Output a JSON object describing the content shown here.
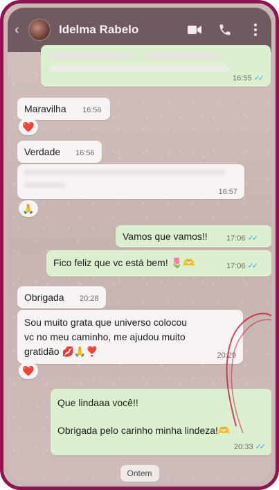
{
  "header": {
    "back_icon": "arrow-left-icon",
    "contact_name": "Idelma Rabelo",
    "actions": [
      "video-call-icon",
      "phone-icon",
      "more-vert-icon"
    ]
  },
  "messages": [
    {
      "id": "m0",
      "direction": "out",
      "text": "",
      "time": "16:55",
      "ticks": "✓✓"
    },
    {
      "id": "m1",
      "direction": "in",
      "text": "Maravilha",
      "time": "16:56",
      "reaction": "❤️"
    },
    {
      "id": "m2",
      "direction": "in",
      "text": "Verdade",
      "time": "16:56"
    },
    {
      "id": "m3",
      "direction": "in",
      "text": "",
      "time": "16:57",
      "reaction": "🙏"
    },
    {
      "id": "m4",
      "direction": "out",
      "text": "Vamos que vamos!!",
      "time": "17:06",
      "ticks": "✓✓"
    },
    {
      "id": "m5",
      "direction": "out",
      "text": "Fico feliz que vc está bem! 🌷🫶",
      "time": "17:06",
      "ticks": "✓✓"
    },
    {
      "id": "m6",
      "direction": "in",
      "text": "Obrigada",
      "time": "20:28"
    },
    {
      "id": "m7",
      "direction": "in",
      "lines": [
        "Sou muito grata que universo colocou",
        "vc no meu caminho, me ajudou muito",
        "gratidão 💋🙏❣️"
      ],
      "time": "20:29",
      "reaction": "❤️"
    },
    {
      "id": "m8",
      "direction": "out",
      "lines": [
        "Que lindaaa você!!",
        "",
        "Obrigada pelo carinho minha lindeza!🫶"
      ],
      "time": "20:33",
      "ticks": "✓✓"
    }
  ],
  "day_separator": "Ontem",
  "colors": {
    "frame": "#8c1450",
    "header": "#6f5a60",
    "incoming_bubble": "#f7f3f3",
    "outgoing_bubble": "#dcefcf",
    "read_ticks": "#4fa5df",
    "doodle_heart": "#c0283e"
  }
}
